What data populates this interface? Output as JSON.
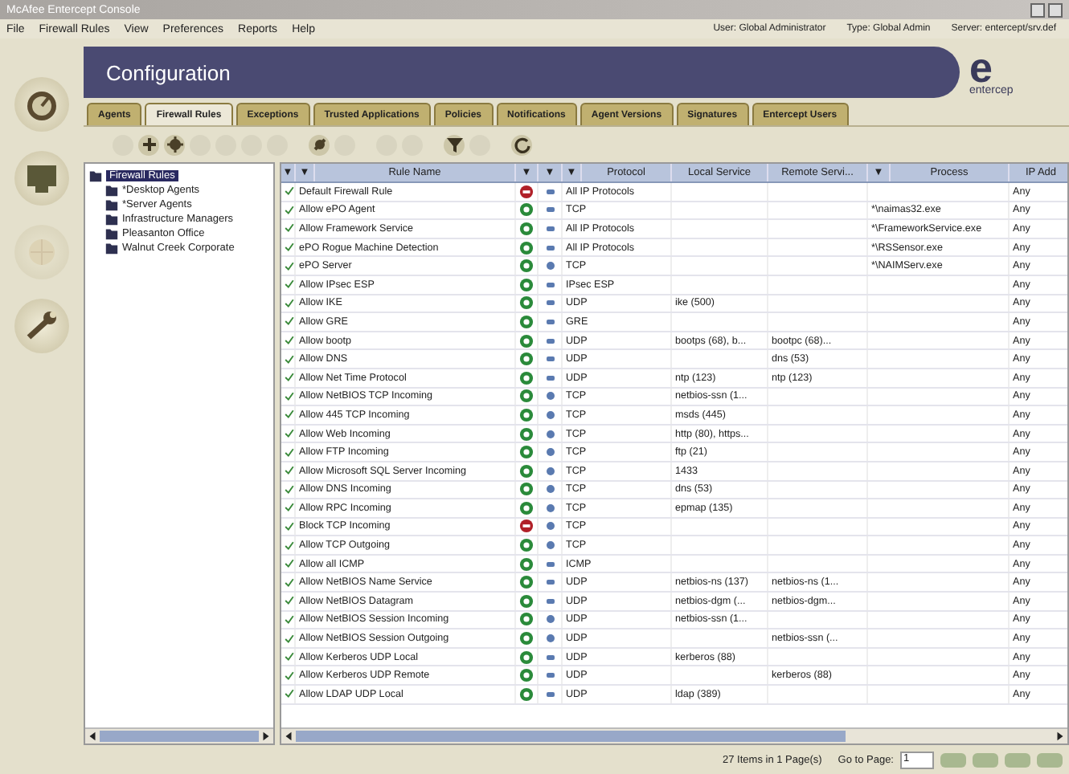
{
  "window": {
    "title": "McAfee Entercept Console"
  },
  "menu": [
    "File",
    "Firewall Rules",
    "View",
    "Preferences",
    "Reports",
    "Help"
  ],
  "session": [
    "User: Global Administrator",
    "Type: Global Admin",
    "Server: entercept/srv.def"
  ],
  "header": {
    "title": "Configuration",
    "logo_mark": "e",
    "logo_text": "entercep"
  },
  "nav_icons": [
    {
      "kind": "gauge",
      "disabled": false
    },
    {
      "kind": "monitor",
      "disabled": false
    },
    {
      "kind": "globe",
      "disabled": true
    },
    {
      "kind": "wrench",
      "disabled": false
    }
  ],
  "tabs": [
    {
      "label": "Agents",
      "selected": false
    },
    {
      "label": "Firewall Rules",
      "selected": true
    },
    {
      "label": "Exceptions",
      "selected": false
    },
    {
      "label": "Trusted Applications",
      "selected": false
    },
    {
      "label": "Policies",
      "selected": false
    },
    {
      "label": "Notifications",
      "selected": false
    },
    {
      "label": "Agent Versions",
      "selected": false
    },
    {
      "label": "Signatures",
      "selected": false
    },
    {
      "label": "Entercept Users",
      "selected": false
    }
  ],
  "toolbar": [
    [
      {
        "kind": "blank",
        "disabled": true
      },
      {
        "kind": "plus",
        "disabled": false
      },
      {
        "kind": "plus-gear",
        "disabled": false
      },
      {
        "kind": "blank",
        "disabled": true
      },
      {
        "kind": "blank",
        "disabled": true
      },
      {
        "kind": "blank",
        "disabled": true
      },
      {
        "kind": "blank",
        "disabled": true
      }
    ],
    [
      {
        "kind": "gear",
        "disabled": false
      },
      {
        "kind": "blank",
        "disabled": true
      }
    ],
    [
      {
        "kind": "blank",
        "disabled": true
      },
      {
        "kind": "blank",
        "disabled": true
      }
    ],
    [
      {
        "kind": "funnel",
        "disabled": false
      },
      {
        "kind": "blank",
        "disabled": true
      }
    ],
    [
      {
        "kind": "refresh",
        "disabled": false
      }
    ]
  ],
  "tree": {
    "label": "Firewall Rules",
    "selected": true,
    "children": [
      {
        "label": "*Desktop Agents",
        "selected": false
      },
      {
        "label": "*Server Agents",
        "selected": false
      },
      {
        "label": "Infrastructure Managers",
        "selected": false
      },
      {
        "label": "Pleasanton Office",
        "selected": false
      },
      {
        "label": "Walnut Creek Corporate",
        "selected": false
      }
    ]
  },
  "table": {
    "columns": [
      "▼",
      "▼",
      "Rule Name",
      "▼",
      "▼",
      "▼",
      "Protocol",
      "Local Service",
      "Remote Servi...",
      "▼",
      "Process",
      "IP Add"
    ],
    "rows": [
      {
        "enabled": true,
        "name": "Default Firewall Rule",
        "blocked": true,
        "bidirectional": true,
        "protocol": "All IP Protocols",
        "ip": "Any"
      },
      {
        "enabled": true,
        "name": "Allow ePO Agent",
        "blocked": false,
        "bidirectional": true,
        "protocol": "TCP",
        "process": "*\\naimas32.exe",
        "ip": "Any"
      },
      {
        "enabled": true,
        "name": "Allow Framework Service",
        "blocked": false,
        "bidirectional": true,
        "protocol": "All IP Protocols",
        "process": "*\\FrameworkService.exe",
        "ip": "Any"
      },
      {
        "enabled": true,
        "name": "ePO Rogue Machine Detection",
        "blocked": false,
        "bidirectional": true,
        "protocol": "All IP Protocols",
        "process": "*\\RSSensor.exe",
        "ip": "Any"
      },
      {
        "enabled": true,
        "name": "ePO Server",
        "blocked": false,
        "bidirectional": false,
        "protocol": "TCP",
        "process": "*\\NAIMServ.exe",
        "ip": "Any"
      },
      {
        "enabled": true,
        "name": "Allow IPsec ESP",
        "blocked": false,
        "bidirectional": true,
        "protocol": "IPsec ESP",
        "ip": "Any"
      },
      {
        "enabled": true,
        "name": "Allow IKE",
        "blocked": false,
        "bidirectional": true,
        "protocol": "UDP",
        "local": "ike (500)",
        "ip": "Any"
      },
      {
        "enabled": true,
        "name": "Allow GRE",
        "blocked": false,
        "bidirectional": true,
        "protocol": "GRE",
        "ip": "Any"
      },
      {
        "enabled": true,
        "name": "Allow bootp",
        "blocked": false,
        "bidirectional": true,
        "protocol": "UDP",
        "local": "bootps (68), b...",
        "remote": "bootpc (68)...",
        "ip": "Any"
      },
      {
        "enabled": true,
        "name": "Allow DNS",
        "blocked": false,
        "bidirectional": true,
        "protocol": "UDP",
        "remote": "dns (53)",
        "ip": "Any"
      },
      {
        "enabled": true,
        "name": "Allow Net Time Protocol",
        "blocked": false,
        "bidirectional": true,
        "protocol": "UDP",
        "local": "ntp (123)",
        "remote": "ntp (123)",
        "ip": "Any"
      },
      {
        "enabled": true,
        "name": "Allow NetBIOS TCP Incoming",
        "blocked": false,
        "bidirectional": false,
        "protocol": "TCP",
        "local": "netbios-ssn (1...",
        "ip": "Any"
      },
      {
        "enabled": true,
        "name": "Allow 445 TCP Incoming",
        "blocked": false,
        "bidirectional": false,
        "protocol": "TCP",
        "local": "msds (445)",
        "ip": "Any"
      },
      {
        "enabled": true,
        "name": "Allow Web Incoming",
        "blocked": false,
        "bidirectional": false,
        "protocol": "TCP",
        "local": "http (80), https...",
        "ip": "Any"
      },
      {
        "enabled": true,
        "name": "Allow FTP Incoming",
        "blocked": false,
        "bidirectional": false,
        "protocol": "TCP",
        "local": "ftp (21)",
        "ip": "Any"
      },
      {
        "enabled": true,
        "name": "Allow Microsoft SQL Server Incoming",
        "blocked": false,
        "bidirectional": false,
        "protocol": "TCP",
        "local": "1433",
        "ip": "Any"
      },
      {
        "enabled": true,
        "name": "Allow DNS Incoming",
        "blocked": false,
        "bidirectional": false,
        "protocol": "TCP",
        "local": "dns (53)",
        "ip": "Any"
      },
      {
        "enabled": true,
        "name": "Allow RPC Incoming",
        "blocked": false,
        "bidirectional": false,
        "protocol": "TCP",
        "local": "epmap (135)",
        "ip": "Any"
      },
      {
        "enabled": true,
        "name": "Block TCP Incoming",
        "blocked": true,
        "bidirectional": false,
        "protocol": "TCP",
        "ip": "Any"
      },
      {
        "enabled": true,
        "name": "Allow TCP Outgoing",
        "blocked": false,
        "bidirectional": false,
        "protocol": "TCP",
        "ip": "Any"
      },
      {
        "enabled": true,
        "name": "Allow all ICMP",
        "blocked": false,
        "bidirectional": true,
        "protocol": "ICMP",
        "ip": "Any"
      },
      {
        "enabled": true,
        "name": "Allow NetBIOS Name Service",
        "blocked": false,
        "bidirectional": true,
        "protocol": "UDP",
        "local": "netbios-ns (137)",
        "remote": "netbios-ns (1...",
        "ip": "Any"
      },
      {
        "enabled": true,
        "name": "Allow NetBIOS Datagram",
        "blocked": false,
        "bidirectional": true,
        "protocol": "UDP",
        "local": "netbios-dgm (...",
        "remote": "netbios-dgm...",
        "ip": "Any"
      },
      {
        "enabled": true,
        "name": "Allow NetBIOS Session Incoming",
        "blocked": false,
        "bidirectional": false,
        "protocol": "UDP",
        "local": "netbios-ssn (1...",
        "ip": "Any"
      },
      {
        "enabled": true,
        "name": "Allow NetBIOS Session Outgoing",
        "blocked": false,
        "bidirectional": false,
        "protocol": "UDP",
        "remote": "netbios-ssn (...",
        "ip": "Any"
      },
      {
        "enabled": true,
        "name": "Allow Kerberos UDP Local",
        "blocked": false,
        "bidirectional": true,
        "protocol": "UDP",
        "local": "kerberos (88)",
        "ip": "Any"
      },
      {
        "enabled": true,
        "name": "Allow Kerberos UDP Remote",
        "blocked": false,
        "bidirectional": true,
        "protocol": "UDP",
        "remote": "kerberos (88)",
        "ip": "Any"
      },
      {
        "enabled": true,
        "name": "Allow LDAP UDP Local",
        "blocked": false,
        "bidirectional": true,
        "protocol": "UDP",
        "local": "ldap (389)",
        "ip": "Any"
      }
    ]
  },
  "status": {
    "count": "27 Items in 1 Page(s)",
    "goto_label": "Go to Page:",
    "page": "1"
  }
}
